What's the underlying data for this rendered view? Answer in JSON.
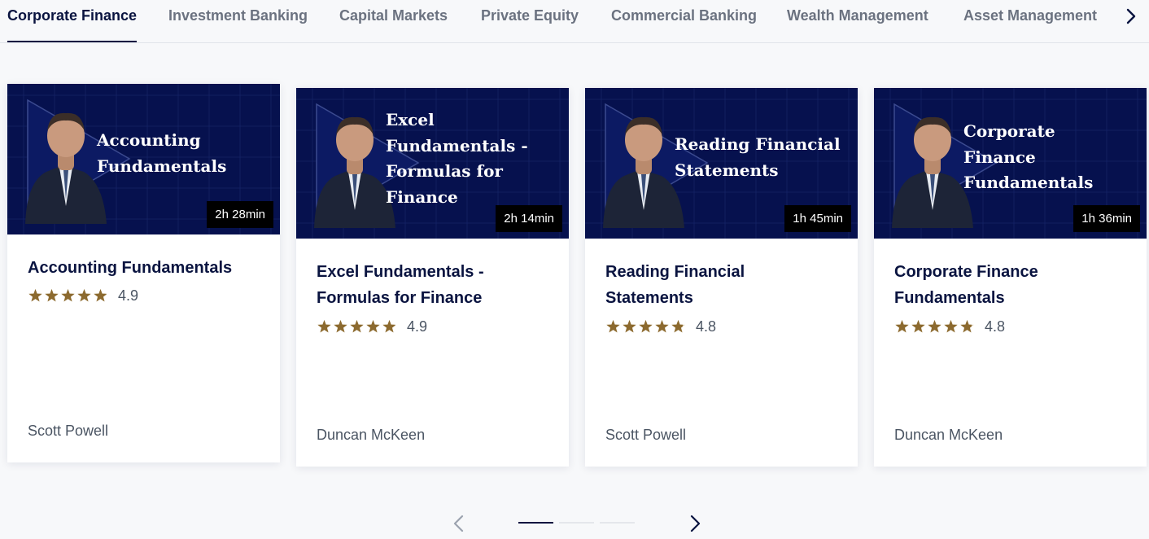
{
  "tabs": [
    {
      "label": "Corporate Finance",
      "active": true
    },
    {
      "label": "Investment Banking",
      "active": false
    },
    {
      "label": "Capital Markets",
      "active": false
    },
    {
      "label": "Private Equity",
      "active": false
    },
    {
      "label": "Commercial Banking",
      "active": false
    },
    {
      "label": "Wealth Management",
      "active": false
    },
    {
      "label": "Asset Management",
      "active": false
    }
  ],
  "tab_next_icon": "chevron-right-icon",
  "courses": [
    {
      "thumb_title": [
        "Accounting",
        "Fundamentals"
      ],
      "duration": "2h 28min",
      "title": "Accounting Fundamentals",
      "rating": "4.9",
      "rating_value": 4.9,
      "instructor": "Scott Powell"
    },
    {
      "thumb_title": [
        "Excel",
        "Fundamentals -",
        "Formulas for",
        "Finance"
      ],
      "duration": "2h 14min",
      "title": "Excel Fundamentals - Formulas for Finance",
      "rating": "4.9",
      "rating_value": 4.9,
      "instructor": "Duncan McKeen"
    },
    {
      "thumb_title": [
        "Reading Financial",
        "Statements"
      ],
      "duration": "1h 45min",
      "title": "Reading Financial Statements",
      "rating": "4.8",
      "rating_value": 4.8,
      "instructor": "Scott Powell"
    },
    {
      "thumb_title": [
        "Corporate",
        "Finance",
        "Fundamentals"
      ],
      "duration": "1h 36min",
      "title": "Corporate Finance Fundamentals",
      "rating": "4.8",
      "rating_value": 4.8,
      "instructor": "Duncan McKeen"
    }
  ],
  "pager": {
    "prev_icon": "chevron-left-icon",
    "next_icon": "chevron-right-icon",
    "pages": 3,
    "current": 1
  },
  "colors": {
    "navy": "#0a1440",
    "thumb_bg": "#06114e",
    "star": "#8c6a2f",
    "muted": "#6b7280"
  }
}
